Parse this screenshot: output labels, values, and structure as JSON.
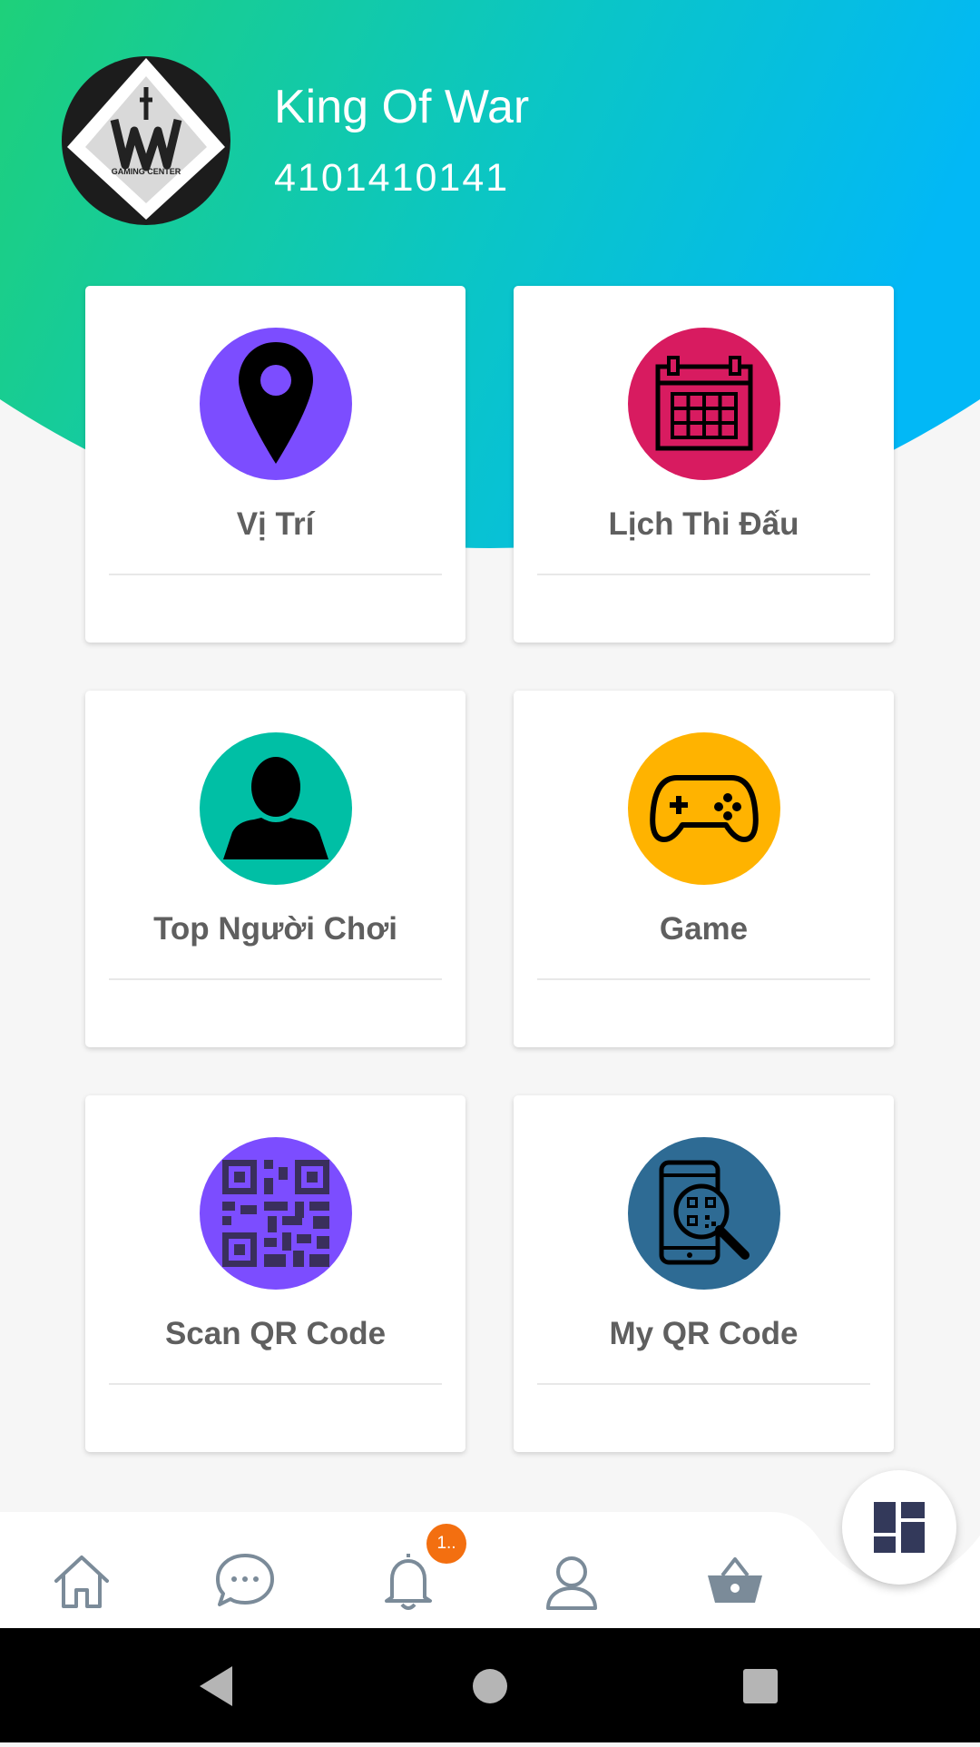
{
  "profile": {
    "name": "King Of War",
    "id": "4101410141",
    "avatar_text": "GAMING CENTER"
  },
  "cards": [
    {
      "label": "Vị Trí",
      "icon": "location-pin-icon",
      "color": "#7c4dff"
    },
    {
      "label": "Lịch Thi Đấu",
      "icon": "calendar-icon",
      "color": "#d81b60"
    },
    {
      "label": "Top Người Chơi",
      "icon": "person-icon",
      "color": "#00bfa5"
    },
    {
      "label": "Game",
      "icon": "gamepad-icon",
      "color": "#ffb300"
    },
    {
      "label": "Scan QR Code",
      "icon": "qr-code-icon",
      "color": "#7c4dff"
    },
    {
      "label": "My QR Code",
      "icon": "phone-qr-search-icon",
      "color": "#2e6b94"
    }
  ],
  "bottom_nav": {
    "items": [
      "home-icon",
      "chat-icon",
      "bell-icon",
      "user-icon",
      "basket-icon"
    ],
    "notification_badge": "1..",
    "fab_icon": "dashboard-icon"
  },
  "colors": {
    "gradient_start": "#1ed07a",
    "gradient_end": "#03b8f4",
    "label": "#5f5f5f",
    "nav_icon": "#7b8b99",
    "badge": "#f36f10"
  }
}
